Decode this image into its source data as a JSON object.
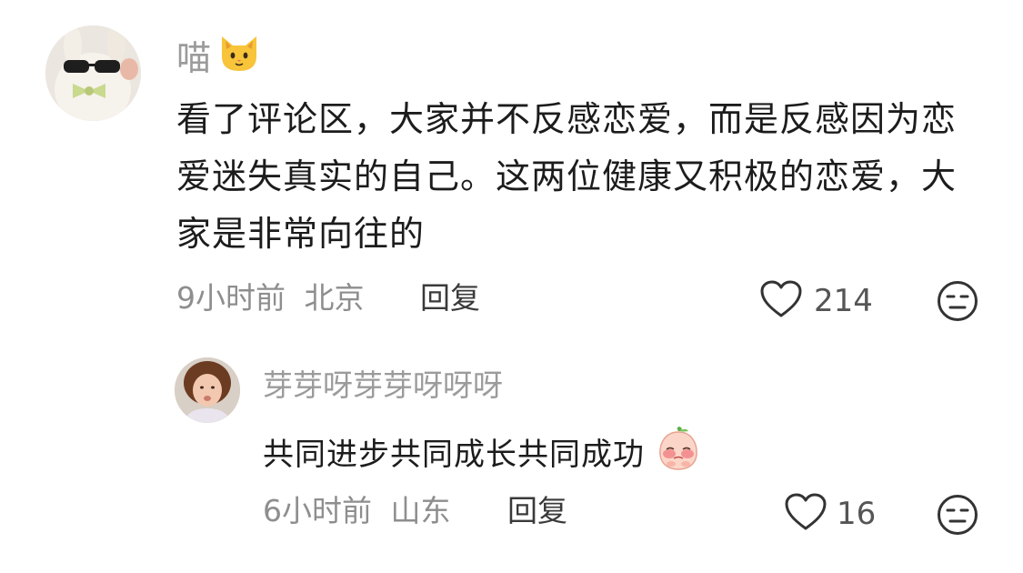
{
  "comments": [
    {
      "username": "喵",
      "username_emoji": "cat-face-emoji",
      "text": "看了评论区，大家并不反感恋爱，而是反感因为恋爱迷失真实的自己。这两位健康又积极的恋爱，大家是非常向往的",
      "time": "9小时前",
      "location": "北京",
      "reply_label": "回复",
      "likes": "214"
    }
  ],
  "reply": {
    "username": "芽芽呀芽芽呀呀呀",
    "text": "共同进步共同成长共同成功",
    "text_emoji": "shy-peach-emoji",
    "time": "6小时前",
    "location": "山东",
    "reply_label": "回复",
    "likes": "16"
  },
  "colors": {
    "username": "#9b9b9b",
    "text": "#1c1c1c",
    "meta": "#8e8e8e",
    "icon_stroke": "#333333"
  }
}
